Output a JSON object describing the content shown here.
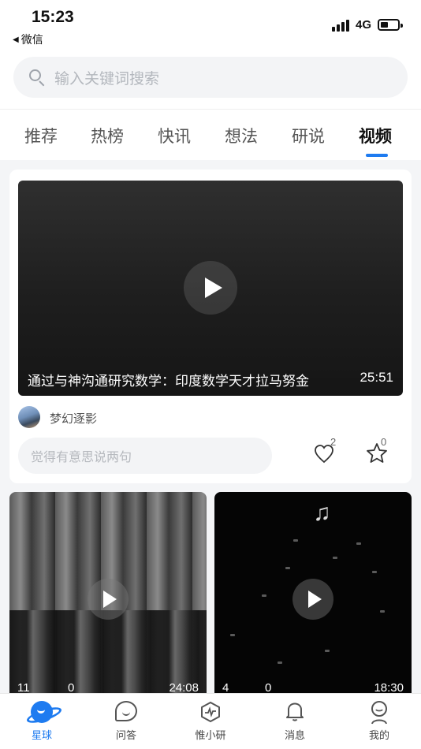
{
  "status_bar": {
    "time": "15:23",
    "back_app": "微信",
    "network": "4G"
  },
  "search": {
    "placeholder": "输入关键词搜索"
  },
  "tabs": [
    {
      "label": "推荐",
      "active": false
    },
    {
      "label": "热榜",
      "active": false
    },
    {
      "label": "快讯",
      "active": false
    },
    {
      "label": "想法",
      "active": false
    },
    {
      "label": "研说",
      "active": false
    },
    {
      "label": "视频",
      "active": true
    }
  ],
  "featured": {
    "title": "通过与神沟通研究数学：印度数学天才拉马努金",
    "duration": "25:51",
    "author": "梦幻逐影",
    "comment_placeholder": "觉得有意思说两句",
    "likes": "2",
    "favorites": "0"
  },
  "videos": [
    {
      "photos": "11",
      "likes": "0",
      "duration": "24:08"
    },
    {
      "photos": "4",
      "likes": "0",
      "duration": "18:30"
    }
  ],
  "bottom_nav": [
    {
      "label": "星球",
      "active": true,
      "icon": "planet-icon"
    },
    {
      "label": "问答",
      "active": false,
      "icon": "chat-bubble-icon"
    },
    {
      "label": "惟小研",
      "active": false,
      "icon": "hexagon-pulse-icon"
    },
    {
      "label": "消息",
      "active": false,
      "icon": "bell-icon"
    },
    {
      "label": "我的",
      "active": false,
      "icon": "profile-icon"
    }
  ],
  "colors": {
    "accent": "#1e7bf0",
    "background": "#f4f5f7"
  }
}
